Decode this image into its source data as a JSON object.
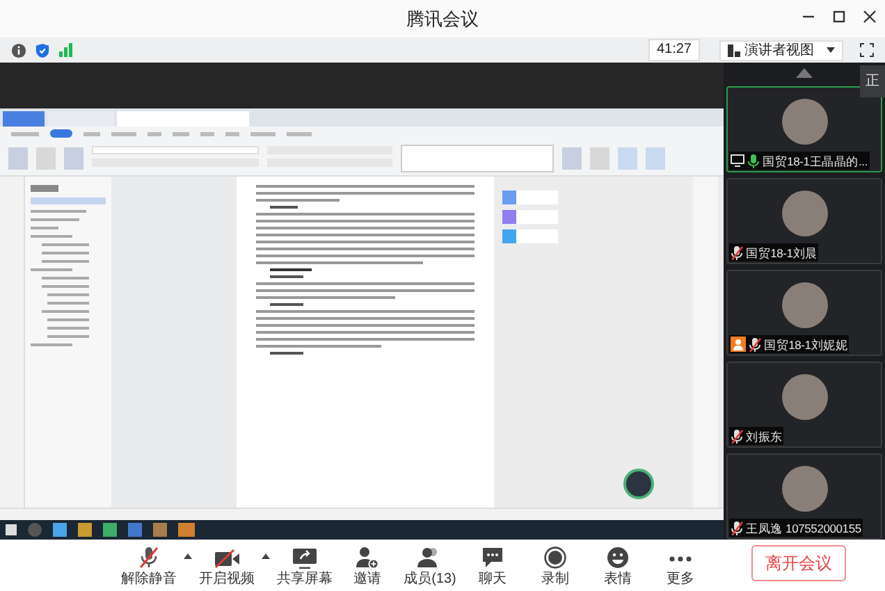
{
  "window": {
    "title": "腾讯会议"
  },
  "info_bar": {
    "timer": "41:27",
    "view_button": "演讲者视图"
  },
  "tooltip": "正",
  "participants": [
    {
      "name": "国贸18-1王晶晶的...",
      "muted": false,
      "selected": true,
      "sharing": true,
      "host": false
    },
    {
      "name": "国贸18-1刘晨",
      "muted": true,
      "selected": false,
      "sharing": false,
      "host": false
    },
    {
      "name": "国贸18-1刘妮妮",
      "muted": true,
      "selected": false,
      "sharing": false,
      "host": true
    },
    {
      "name": "刘振东",
      "muted": true,
      "selected": false,
      "sharing": false,
      "host": false
    },
    {
      "name": "王凤逸 107552000155",
      "muted": true,
      "selected": false,
      "sharing": false,
      "host": false
    }
  ],
  "toolbar": {
    "buttons": [
      {
        "kind": "mic",
        "label": "解除静音",
        "off": true,
        "menu": true
      },
      {
        "kind": "video",
        "label": "开启视频",
        "off": true,
        "menu": true
      },
      {
        "kind": "share",
        "label": "共享屏幕"
      },
      {
        "kind": "invite",
        "label": "邀请"
      },
      {
        "kind": "members",
        "label": "成员(13)"
      },
      {
        "kind": "chat",
        "label": "聊天"
      },
      {
        "kind": "record",
        "label": "录制"
      },
      {
        "kind": "emoji",
        "label": "表情"
      },
      {
        "kind": "more",
        "label": "更多"
      }
    ],
    "leave_button": "离开会议"
  }
}
